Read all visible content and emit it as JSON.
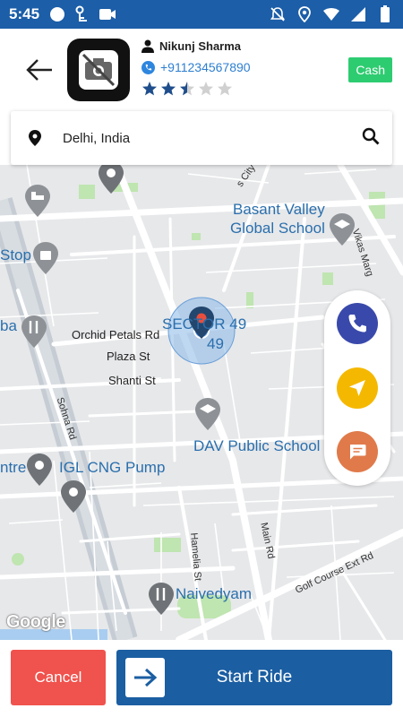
{
  "status_bar": {
    "time": "5:45",
    "left_icons": [
      "circle-icon",
      "key-icon",
      "camera-icon"
    ],
    "right_icons": [
      "notifications-off-icon",
      "location-icon",
      "wifi-icon",
      "signal-icon",
      "battery-icon"
    ],
    "bg_color": "#1c5ea8"
  },
  "header": {
    "driver_name": "Nikunj Sharma",
    "phone": "+911234567890",
    "rating": 2.5,
    "rating_max": 5,
    "payment_badge": "Cash",
    "badge_color": "#2ecc71"
  },
  "location_bar": {
    "value": "Delhi, India"
  },
  "map": {
    "labels": {
      "basant": "Basant Valley",
      "global": "Global School",
      "sector": "SECTOR 49",
      "sector_num": "49",
      "orchid": "Orchid Petals Rd",
      "plaza": "Plaza St",
      "shanti": "Shanti St",
      "dav": "DAV Public School",
      "igl": "IGL CNG Pump",
      "naivedyam": "Naivedyam",
      "stop": "Stop",
      "ba": "ba",
      "ntre": "ntre",
      "city_rd": "s City Rd",
      "vikas": "Vikas Marg",
      "sohna": "Sohna Rd",
      "main_rd": "Main Rd",
      "hamelia": "Hamelia St",
      "golf": "Golf Course Ext Rd"
    },
    "attribution": "Google"
  },
  "actions": {
    "call_color": "#3949ab",
    "navigate_color": "#f5b800",
    "chat_color": "#e07a4a"
  },
  "bottom": {
    "cancel_label": "Cancel",
    "start_label": "Start Ride",
    "cancel_color": "#f0524d",
    "start_color": "#1b5ea2"
  }
}
